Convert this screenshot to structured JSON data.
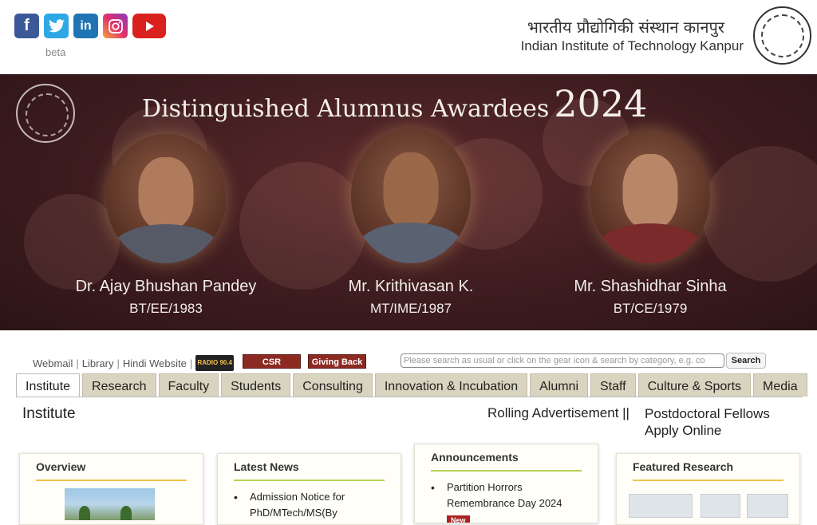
{
  "header": {
    "social": [
      {
        "name": "facebook-icon",
        "glyph": "f"
      },
      {
        "name": "twitter-icon",
        "glyph": ""
      },
      {
        "name": "linkedin-icon",
        "glyph": "in"
      },
      {
        "name": "instagram-icon",
        "glyph": ""
      },
      {
        "name": "youtube-icon",
        "glyph": ""
      }
    ],
    "beta": "beta",
    "institute_hindi": "भारतीय प्रौद्योगिकी संस्थान कानपुर",
    "institute_english": "Indian Institute of Technology Kanpur"
  },
  "banner": {
    "title": "Distinguished Alumnus Awardees",
    "year": "2024",
    "people": [
      {
        "name": "Dr. Ajay Bhushan Pandey",
        "code": "BT/EE/1983"
      },
      {
        "name": "Mr. Krithivasan K.",
        "code": "MT/IME/1987"
      },
      {
        "name": "Mr. Shashidhar Sinha",
        "code": "BT/CE/1979"
      }
    ]
  },
  "toplinks": {
    "webmail": "Webmail",
    "library": "Library",
    "hindi": "Hindi Website",
    "radio": "RADIO 90.4",
    "csr": "CSR",
    "giving_back": "Giving Back",
    "sep": "|"
  },
  "search": {
    "placeholder": "Please search as usual or click on the gear icon & search by category, e.g. co",
    "button": "Search"
  },
  "tabs": [
    "Institute",
    "Research",
    "Faculty",
    "Students",
    "Consulting",
    "Innovation & Incubation",
    "Alumni",
    "Staff",
    "Culture & Sports",
    "Media"
  ],
  "main": {
    "section_title": "Institute",
    "rolling": "Rolling Advertisement ||",
    "postdoc_line1": "Postdoctoral Fellows",
    "postdoc_line2": "Apply Online"
  },
  "cards": {
    "overview": {
      "title": "Overview"
    },
    "news": {
      "title": "Latest News",
      "items": [
        "Admission Notice for PhD/MTech/MS(By"
      ]
    },
    "announcements": {
      "title": "Announcements",
      "items": [
        "Partition Horrors Remembrance Day 2024"
      ],
      "badge": "New"
    },
    "research": {
      "title": "Featured Research"
    }
  }
}
